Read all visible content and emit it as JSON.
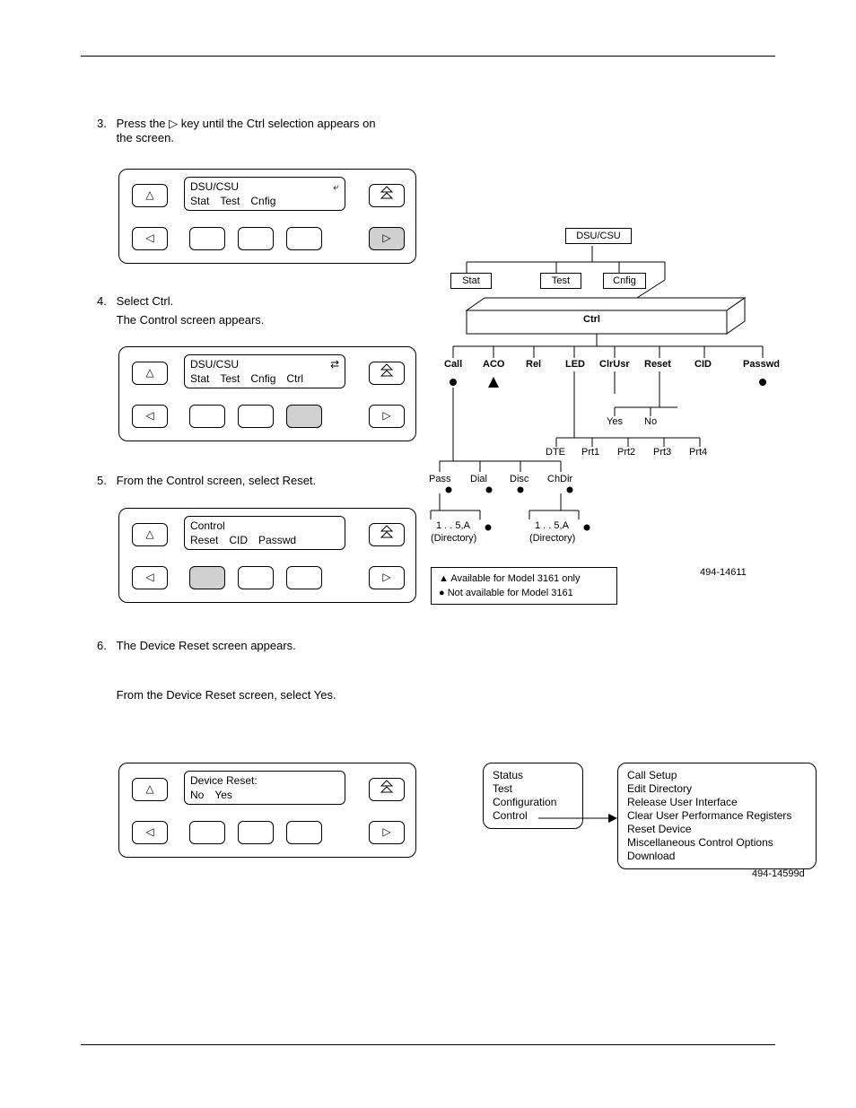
{
  "steps": {
    "s3": {
      "num": "3.",
      "text_pre": "Press the ",
      "sym": "▷",
      "text_post": " key until the Ctrl selection appears on the screen."
    },
    "s4": {
      "num": "4.",
      "text_a": "Select Ctrl.",
      "text_b": "The Control screen appears."
    },
    "s5": {
      "num": "5.",
      "text": "From the Control screen, select Reset."
    },
    "s6": {
      "num": "6.",
      "text_a": "The Device Reset screen appears.",
      "text_b": "From the Device Reset screen, select Yes."
    }
  },
  "panels": {
    "p1": {
      "l1_left": "DSU/CSU",
      "l1_right": "⤶",
      "l2": [
        "Stat",
        "Test",
        "Cnfig"
      ],
      "shaded": "right"
    },
    "p2": {
      "l1_left": "DSU/CSU",
      "l1_right": "⇄",
      "l2": [
        "Stat",
        "Test",
        "Cnfig",
        "Ctrl"
      ],
      "shaded": "f3"
    },
    "p3": {
      "l1_left": "Control",
      "l1_right": "",
      "l2": [
        "Reset",
        "CID",
        "Passwd"
      ],
      "shaded": "f1"
    },
    "p4": {
      "l1_left": "Device Reset:",
      "l1_right": "",
      "l2": [
        "No",
        "Yes"
      ],
      "shaded": "none"
    }
  },
  "tree": {
    "root": "DSU/CSU",
    "top_row": [
      "Stat",
      "Test",
      "Cnfig"
    ],
    "ctrl": "Ctrl",
    "ctrl_children": [
      "Call",
      "ACO",
      "Rel",
      "LED",
      "ClrUsr",
      "Reset",
      "CID",
      "Passwd"
    ],
    "reset_children": [
      "Yes",
      "No"
    ],
    "clrusr_children": [
      "DTE",
      "Prt1",
      "Prt2",
      "Prt3",
      "Prt4"
    ],
    "call_children": [
      "Pass",
      "Dial",
      "Disc",
      "ChDir"
    ],
    "pass_sub": "1 . . 5,A",
    "pass_sub2": "(Directory)",
    "chdir_sub": "1 . . 5,A",
    "chdir_sub2": "(Directory)",
    "legend_tri": "Available for Model 3161 only",
    "legend_dot": "Not available for Model 3161",
    "ref": "494-14611"
  },
  "flow": {
    "left_items": [
      "Status",
      "Test",
      "Configuration",
      "Control"
    ],
    "right_items": [
      "Call Setup",
      "Edit Directory",
      "Release User Interface",
      "Clear User Performance Registers",
      "Reset Device",
      "Miscellaneous Control Options",
      "Download"
    ],
    "ref": "494-14599d"
  }
}
